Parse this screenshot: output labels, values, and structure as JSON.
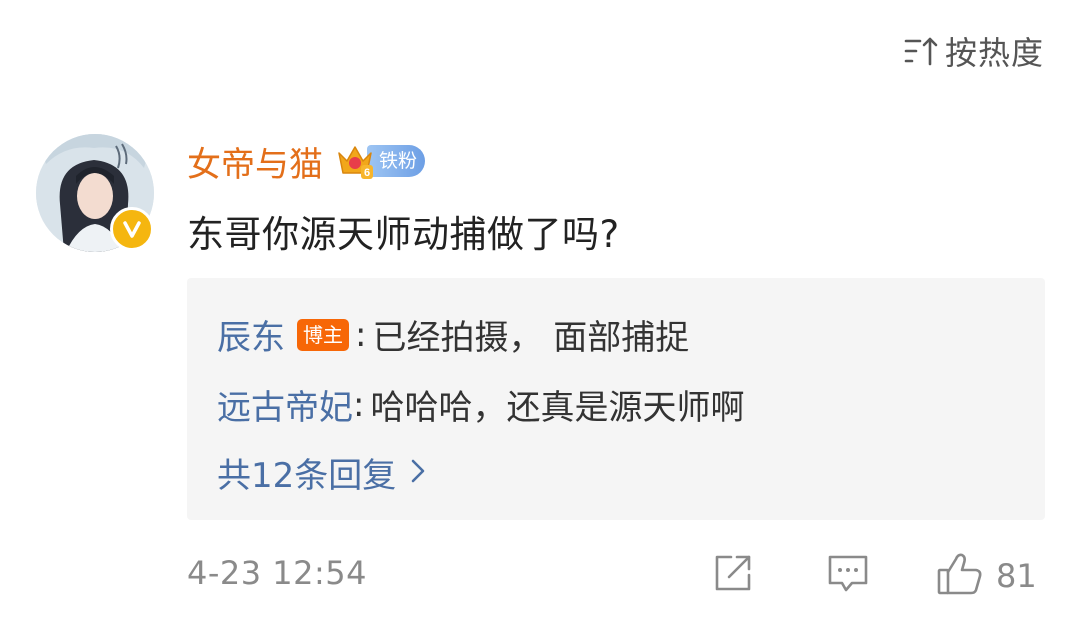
{
  "sort": {
    "label": "按热度",
    "icon": "sort-icon"
  },
  "comment": {
    "author": "女帝与猫",
    "author_color": "#e36f1a",
    "fan_badge": {
      "level": "6",
      "label": "铁粉"
    },
    "text": "东哥你源天师动捕做了吗?",
    "verified": true
  },
  "replies": [
    {
      "user": "辰东",
      "badge": "博主",
      "colon": ":",
      "text": "已经拍摄， 面部捕捉"
    },
    {
      "user": "远古帝妃",
      "colon": ":",
      "text": "哈哈哈，还真是源天师啊"
    }
  ],
  "more_replies": {
    "label": "共12条回复"
  },
  "footer": {
    "timestamp": "4-23 12:54",
    "like_count": "81"
  },
  "colors": {
    "link_blue": "#4a6fa5",
    "blogger_badge": "#f76707",
    "verified_gold": "#f5b60f"
  }
}
